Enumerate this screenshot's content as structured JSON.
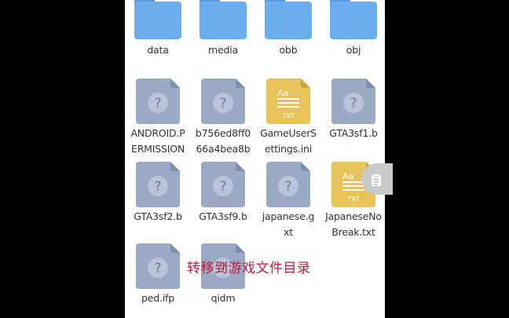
{
  "files": [
    {
      "name": "data",
      "type": "folder"
    },
    {
      "name": "media",
      "type": "folder"
    },
    {
      "name": "obb",
      "type": "folder"
    },
    {
      "name": "obj",
      "type": "folder"
    },
    {
      "name": "ANDROID.PERMISSION",
      "type": "unknown"
    },
    {
      "name": "b756ed8ff066a4bea8b",
      "type": "unknown"
    },
    {
      "name": "GameUserSettings.ini",
      "type": "text"
    },
    {
      "name": "GTA3sf1.b",
      "type": "unknown"
    },
    {
      "name": "GTA3sf2.b",
      "type": "unknown"
    },
    {
      "name": "GTA3sf9.b",
      "type": "unknown"
    },
    {
      "name": "japanese.gxt",
      "type": "unknown"
    },
    {
      "name": "JapaneseNoBreak.txt",
      "type": "text"
    },
    {
      "name": "ped.ifp",
      "type": "unknown"
    },
    {
      "name": "qidm",
      "type": "unknown"
    }
  ],
  "icon_text": {
    "aa": "Aa",
    "txt": "TXT",
    "unknown": "?"
  },
  "overlay_caption": "转移到游戏文件目录",
  "colors": {
    "folder": "#6aaef0",
    "unknown_file": "#9aaac4",
    "text_file": "#e8c35a",
    "caption": "#c8183a"
  },
  "float_button_icon": "clipboard-icon"
}
